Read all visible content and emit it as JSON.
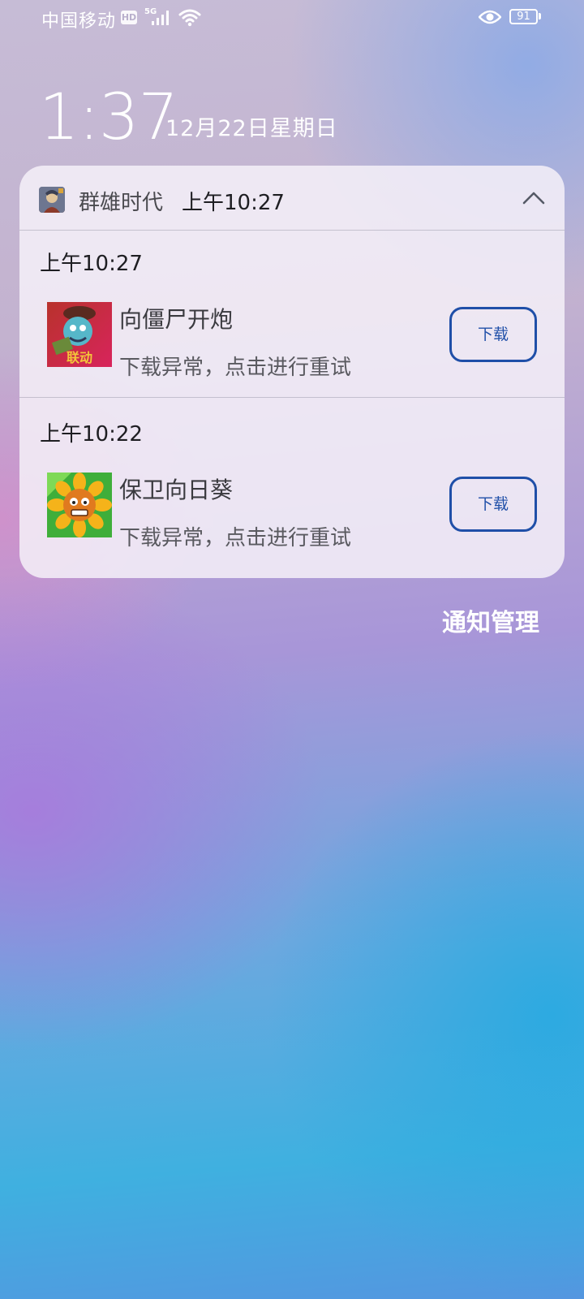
{
  "status_bar": {
    "carrier": "中国移动",
    "hd": "HD",
    "network": "5G",
    "battery": "91"
  },
  "lockscreen": {
    "time": "1:37",
    "date": "12月22日星期日"
  },
  "notification": {
    "app_name": "群雄时代",
    "time": "上午10:27",
    "items": [
      {
        "time": "上午10:27",
        "title": "向僵尸开炮",
        "subtitle": "下载异常，点击进行重试",
        "button": "下载"
      },
      {
        "time": "上午10:22",
        "title": "保卫向日葵",
        "subtitle": "下载异常，点击进行重试",
        "button": "下载"
      }
    ]
  },
  "manage_label": "通知管理"
}
